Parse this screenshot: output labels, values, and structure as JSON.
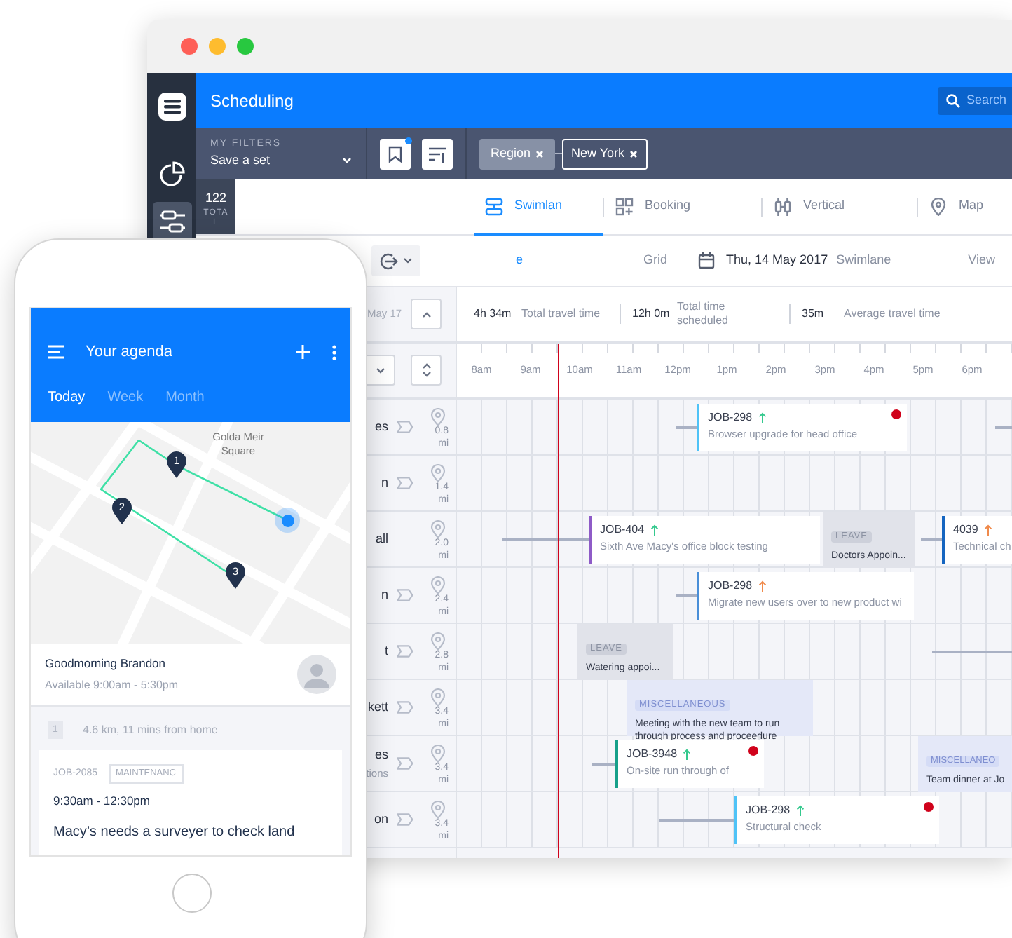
{
  "app": {
    "title": "Scheduling",
    "search": {
      "placeholder": "Search"
    }
  },
  "sidebar": [
    {
      "kind": "logo",
      "selected": false
    },
    {
      "kind": "chart",
      "selected": false
    },
    {
      "kind": "swimlane",
      "selected": true
    }
  ],
  "filters": {
    "label": "MY FILTERS",
    "value": "Save a set",
    "tools": [
      {
        "kind": "bookmark",
        "badge": true
      },
      {
        "kind": "sort",
        "badge": false
      }
    ],
    "chips": [
      {
        "label": "Region",
        "kind": "key"
      },
      {
        "label": "New York",
        "kind": "value"
      }
    ]
  },
  "total": {
    "count": "122",
    "label": "TOTAL"
  },
  "view_tabs": [
    {
      "label": "Swimlan",
      "kind": "swimlane",
      "selected": true
    },
    {
      "label": "Booking",
      "kind": "booking",
      "selected": false
    },
    {
      "label": "Vertical",
      "kind": "vertical",
      "selected": false
    },
    {
      "label": "Map",
      "kind": "map",
      "selected": false
    }
  ],
  "toolbar": {
    "fragment": "e",
    "grid": "Grid",
    "date": "Thu, 14 May 2017",
    "mode": "Swimlane",
    "view": "View"
  },
  "left_panel": {
    "date": "May 17"
  },
  "stats": [
    {
      "value": "4h 34m",
      "label": "Total travel time"
    },
    {
      "value": "12h 0m",
      "label": "Total time scheduled"
    },
    {
      "value": "35m",
      "label": "Average travel time"
    }
  ],
  "hours": [
    "8am",
    "9am",
    "10am",
    "11am",
    "12pm",
    "1pm",
    "2pm",
    "3pm",
    "4pm",
    "5pm",
    "6pm"
  ],
  "lanes": [
    {
      "name": "es",
      "tag_icon": true,
      "distance": "0.8 mi",
      "items": [
        {
          "kind": "link"
        },
        {
          "kind": "job",
          "id": "JOB-298",
          "urgent": false,
          "description": "Browser upgrade for head office",
          "color": "#4fc3f7",
          "alert": true
        },
        {
          "kind": "link"
        }
      ]
    },
    {
      "name": "n",
      "tag_icon": true,
      "distance": "1.4 mi"
    },
    {
      "name": "all",
      "tag_icon": false,
      "distance": "2.0 mi",
      "items": [
        {
          "kind": "link"
        },
        {
          "kind": "job",
          "id": "JOB-404",
          "urgent": false,
          "description": "Sixth Ave Macy's office block testing",
          "color": "#8e5bc7",
          "alert": false
        },
        {
          "kind": "leave",
          "tag": "LEAVE",
          "text": "Doctors Appoin..."
        },
        {
          "kind": "link"
        },
        {
          "kind": "job",
          "id": "4039",
          "urgent": true,
          "description": "Technical ch",
          "color": "#1565c0",
          "alert": false
        }
      ]
    },
    {
      "name": "n",
      "tag_icon": true,
      "distance": "2.4 mi",
      "items": [
        {
          "kind": "link"
        },
        {
          "kind": "job",
          "id": "JOB-298",
          "urgent": true,
          "description": "Migrate new users over to new product wi",
          "color": "#4a8fd8",
          "alert": false
        }
      ]
    },
    {
      "name": "t",
      "tag_icon": true,
      "distance": "2.8 mi",
      "items": [
        {
          "kind": "leave",
          "tag": "LEAVE",
          "text": "Watering appoi..."
        },
        {
          "kind": "link"
        }
      ]
    },
    {
      "name": "kett",
      "tag_icon": true,
      "distance": "3.4 mi",
      "items": [
        {
          "kind": "misc",
          "tag": "MISCELLANEOUS",
          "text": "Meeting with the new team to run through process and proceedure"
        }
      ]
    },
    {
      "name": "es",
      "subtitle": "tions",
      "tag_icon": true,
      "distance": "3.4 mi",
      "items": [
        {
          "kind": "link"
        },
        {
          "kind": "job",
          "id": "JOB-3948",
          "urgent": false,
          "description": "On-site run through of",
          "color": "#16a08a",
          "alert": true
        },
        {
          "kind": "misc",
          "tag": "MISCELLANEO",
          "text": "Team dinner at Jo"
        }
      ]
    },
    {
      "name": "on",
      "tag_icon": true,
      "distance": "3.4 mi",
      "items": [
        {
          "kind": "link"
        },
        {
          "kind": "job",
          "id": "JOB-298",
          "urgent": false,
          "description": "Structural check",
          "color": "#4fc3f7",
          "alert": true
        }
      ]
    }
  ],
  "agenda": {
    "title": "Your agenda",
    "tabs": [
      {
        "label": "Today",
        "selected": true
      },
      {
        "label": "Week",
        "selected": false
      },
      {
        "label": "Month",
        "selected": false
      }
    ],
    "map": {
      "label": "Golda Meir Square",
      "pins": [
        "1",
        "2",
        "3"
      ]
    },
    "greeting": "Goodmorning Brandon",
    "availability": "Available 9:00am - 5:30pm",
    "route": {
      "step": "1",
      "text": "4.6 km, 11 mins from home"
    },
    "job": {
      "id": "JOB-2085",
      "tag": "MAINTENANC",
      "time": "9:30am - 12:30pm",
      "title": "Macy’s needs a surveyer to check land"
    }
  }
}
